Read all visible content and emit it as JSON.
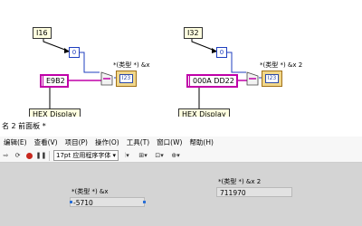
{
  "diagram": {
    "left": {
      "type_label": "I16",
      "zero_const": "0",
      "hex_value": "E9B2",
      "indicator_caption": "*(类型 *) &x",
      "indicator_text": "I23",
      "hex_tag": "HEX Display"
    },
    "right": {
      "type_label": "I32",
      "zero_const": "0",
      "hex_value": "000A DD22",
      "indicator_caption": "*(类型 *) &x 2",
      "indicator_text": "I23",
      "hex_tag": "HEX Display"
    }
  },
  "front_panel": {
    "title": "名 2 前面板 *",
    "menu": [
      "编辑(E)",
      "查看(V)",
      "项目(P)",
      "操作(O)",
      "工具(T)",
      "窗口(W)",
      "帮助(H)"
    ],
    "font_label": "17pt 应用程序字体",
    "indicators": [
      {
        "caption": "*(类型 *) &x",
        "value": "-5710"
      },
      {
        "caption": "*(类型 *) &x 2",
        "value": "711970"
      }
    ]
  },
  "colors": {
    "hex_wire": "#c000a8",
    "num_wire": "#1f3fbf",
    "panel_bg": "#d4d4d4"
  }
}
